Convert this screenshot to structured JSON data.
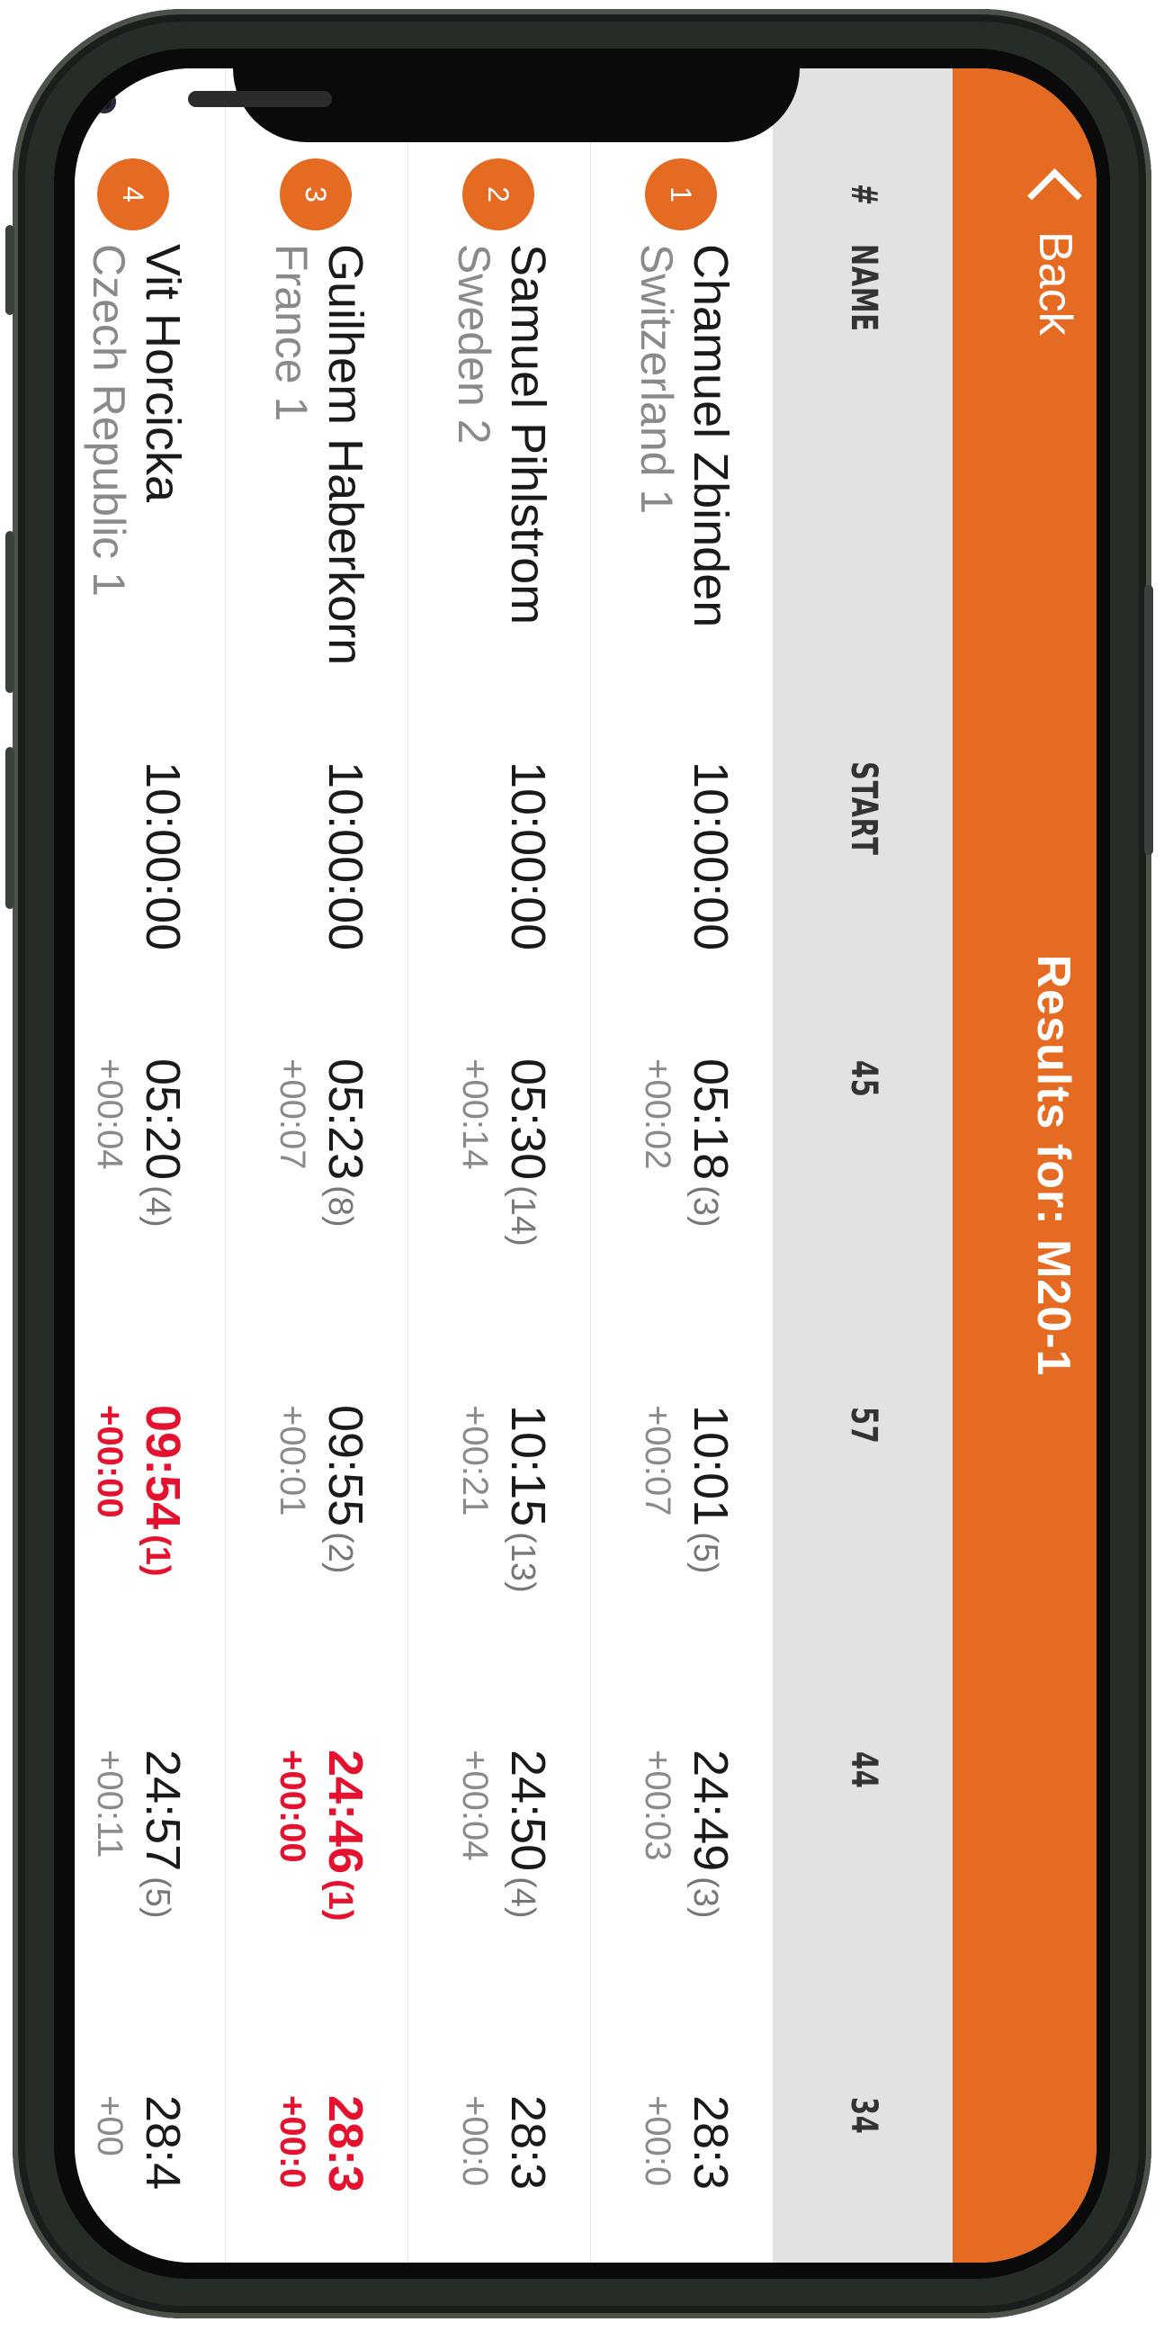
{
  "header": {
    "back_label": "Back",
    "title": "Results for: M20-1",
    "color": "#e56b22"
  },
  "columns": [
    "#",
    "NAME",
    "START",
    "45",
    "57",
    "44",
    "34"
  ],
  "highlight_color": "#e5122f",
  "rows": [
    {
      "rank": "1",
      "name": "Chamuel Zbinden",
      "team": "Switzerland 1",
      "start": "10:00:00",
      "splits": [
        {
          "time": "05:18",
          "rank": "(3)",
          "diff": "+00:02",
          "best": false
        },
        {
          "time": "10:01",
          "rank": "(5)",
          "diff": "+00:07",
          "best": false
        },
        {
          "time": "24:49",
          "rank": "(3)",
          "diff": "+00:03",
          "best": false
        },
        {
          "time": "28:3",
          "rank": "",
          "diff": "+00:0",
          "best": false
        }
      ]
    },
    {
      "rank": "2",
      "name": "Samuel Pihlstrom",
      "team": "Sweden 2",
      "start": "10:00:00",
      "splits": [
        {
          "time": "05:30",
          "rank": "(14)",
          "diff": "+00:14",
          "best": false
        },
        {
          "time": "10:15",
          "rank": "(13)",
          "diff": "+00:21",
          "best": false
        },
        {
          "time": "24:50",
          "rank": "(4)",
          "diff": "+00:04",
          "best": false
        },
        {
          "time": "28:3",
          "rank": "",
          "diff": "+00:0",
          "best": false
        }
      ]
    },
    {
      "rank": "3",
      "name": "Guilhem Haberkorn",
      "team": "France 1",
      "start": "10:00:00",
      "splits": [
        {
          "time": "05:23",
          "rank": "(8)",
          "diff": "+00:07",
          "best": false
        },
        {
          "time": "09:55",
          "rank": "(2)",
          "diff": "+00:01",
          "best": false
        },
        {
          "time": "24:46",
          "rank": "(1)",
          "diff": "+00:00",
          "best": true
        },
        {
          "time": "28:3",
          "rank": "",
          "diff": "+00:0",
          "best": true
        }
      ]
    },
    {
      "rank": "4",
      "name": "Vit Horcicka",
      "team": "Czech Republic 1",
      "start": "10:00:00",
      "splits": [
        {
          "time": "05:20",
          "rank": "(4)",
          "diff": "+00:04",
          "best": false
        },
        {
          "time": "09:54",
          "rank": "(1)",
          "diff": "+00:00",
          "best": true
        },
        {
          "time": "24:57",
          "rank": "(5)",
          "diff": "+00:11",
          "best": false
        },
        {
          "time": "28:4",
          "rank": "",
          "diff": "+00",
          "best": false
        }
      ]
    }
  ]
}
